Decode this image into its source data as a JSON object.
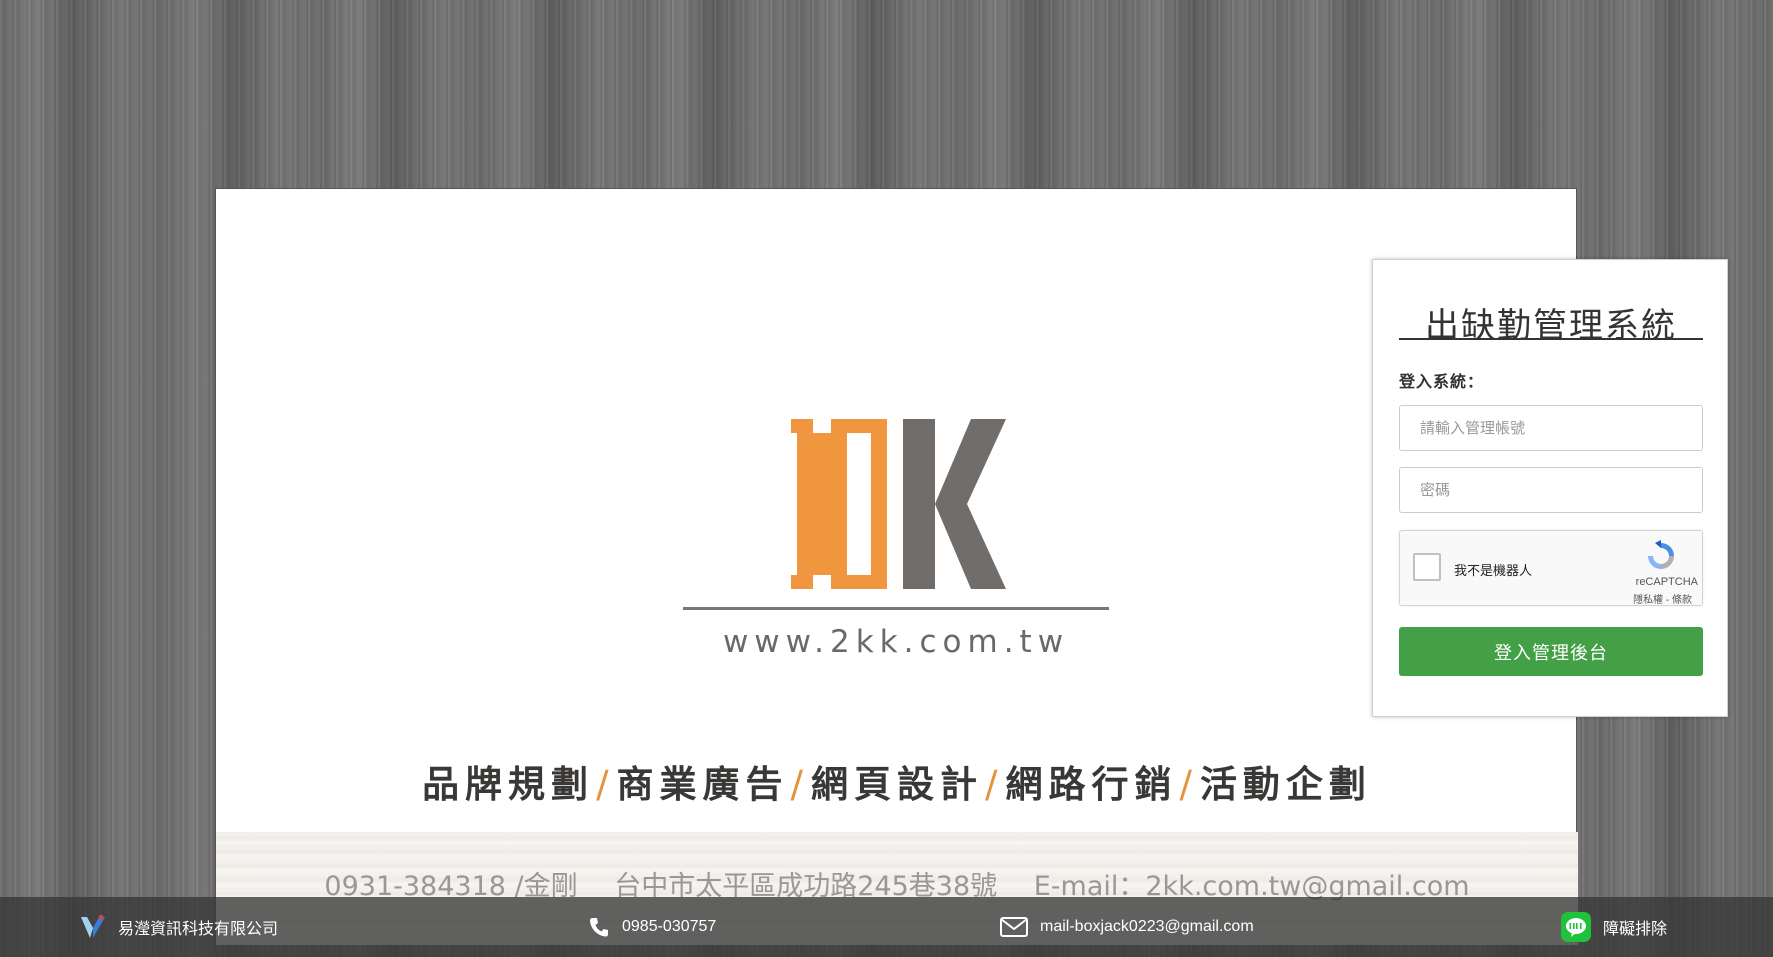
{
  "banner": {
    "website": "www.2kk.com.tw",
    "services": [
      "品牌規劃",
      "商業廣告",
      "網頁設計",
      "網路行銷",
      "活動企劃"
    ],
    "separator": "/",
    "contact": {
      "phone": "0931-384318 /金剛",
      "address": "台中市太平區成功路245巷38號",
      "email": "E-mail：2kk.com.tw@gmail.com"
    },
    "colors": {
      "accent_orange": "#f0963f",
      "logo_gray": "#716d6a"
    }
  },
  "login": {
    "title": "出缺勤管理系統",
    "section_label": "登入系統：",
    "username_placeholder": "請輸入管理帳號",
    "password_placeholder": "密碼",
    "captcha": {
      "label": "我不是機器人",
      "brand": "reCAPTCHA",
      "links": "隱私權 - 條款"
    },
    "submit_label": "登入管理後台",
    "colors": {
      "submit": "#43a047"
    }
  },
  "footer": {
    "company": "易瀅資訊科技有限公司",
    "phone": "0985-030757",
    "email": "mail-boxjack0223@gmail.com",
    "support": "障礙排除",
    "icons": [
      "company-logo-icon",
      "phone-icon",
      "envelope-icon",
      "line-icon"
    ]
  }
}
